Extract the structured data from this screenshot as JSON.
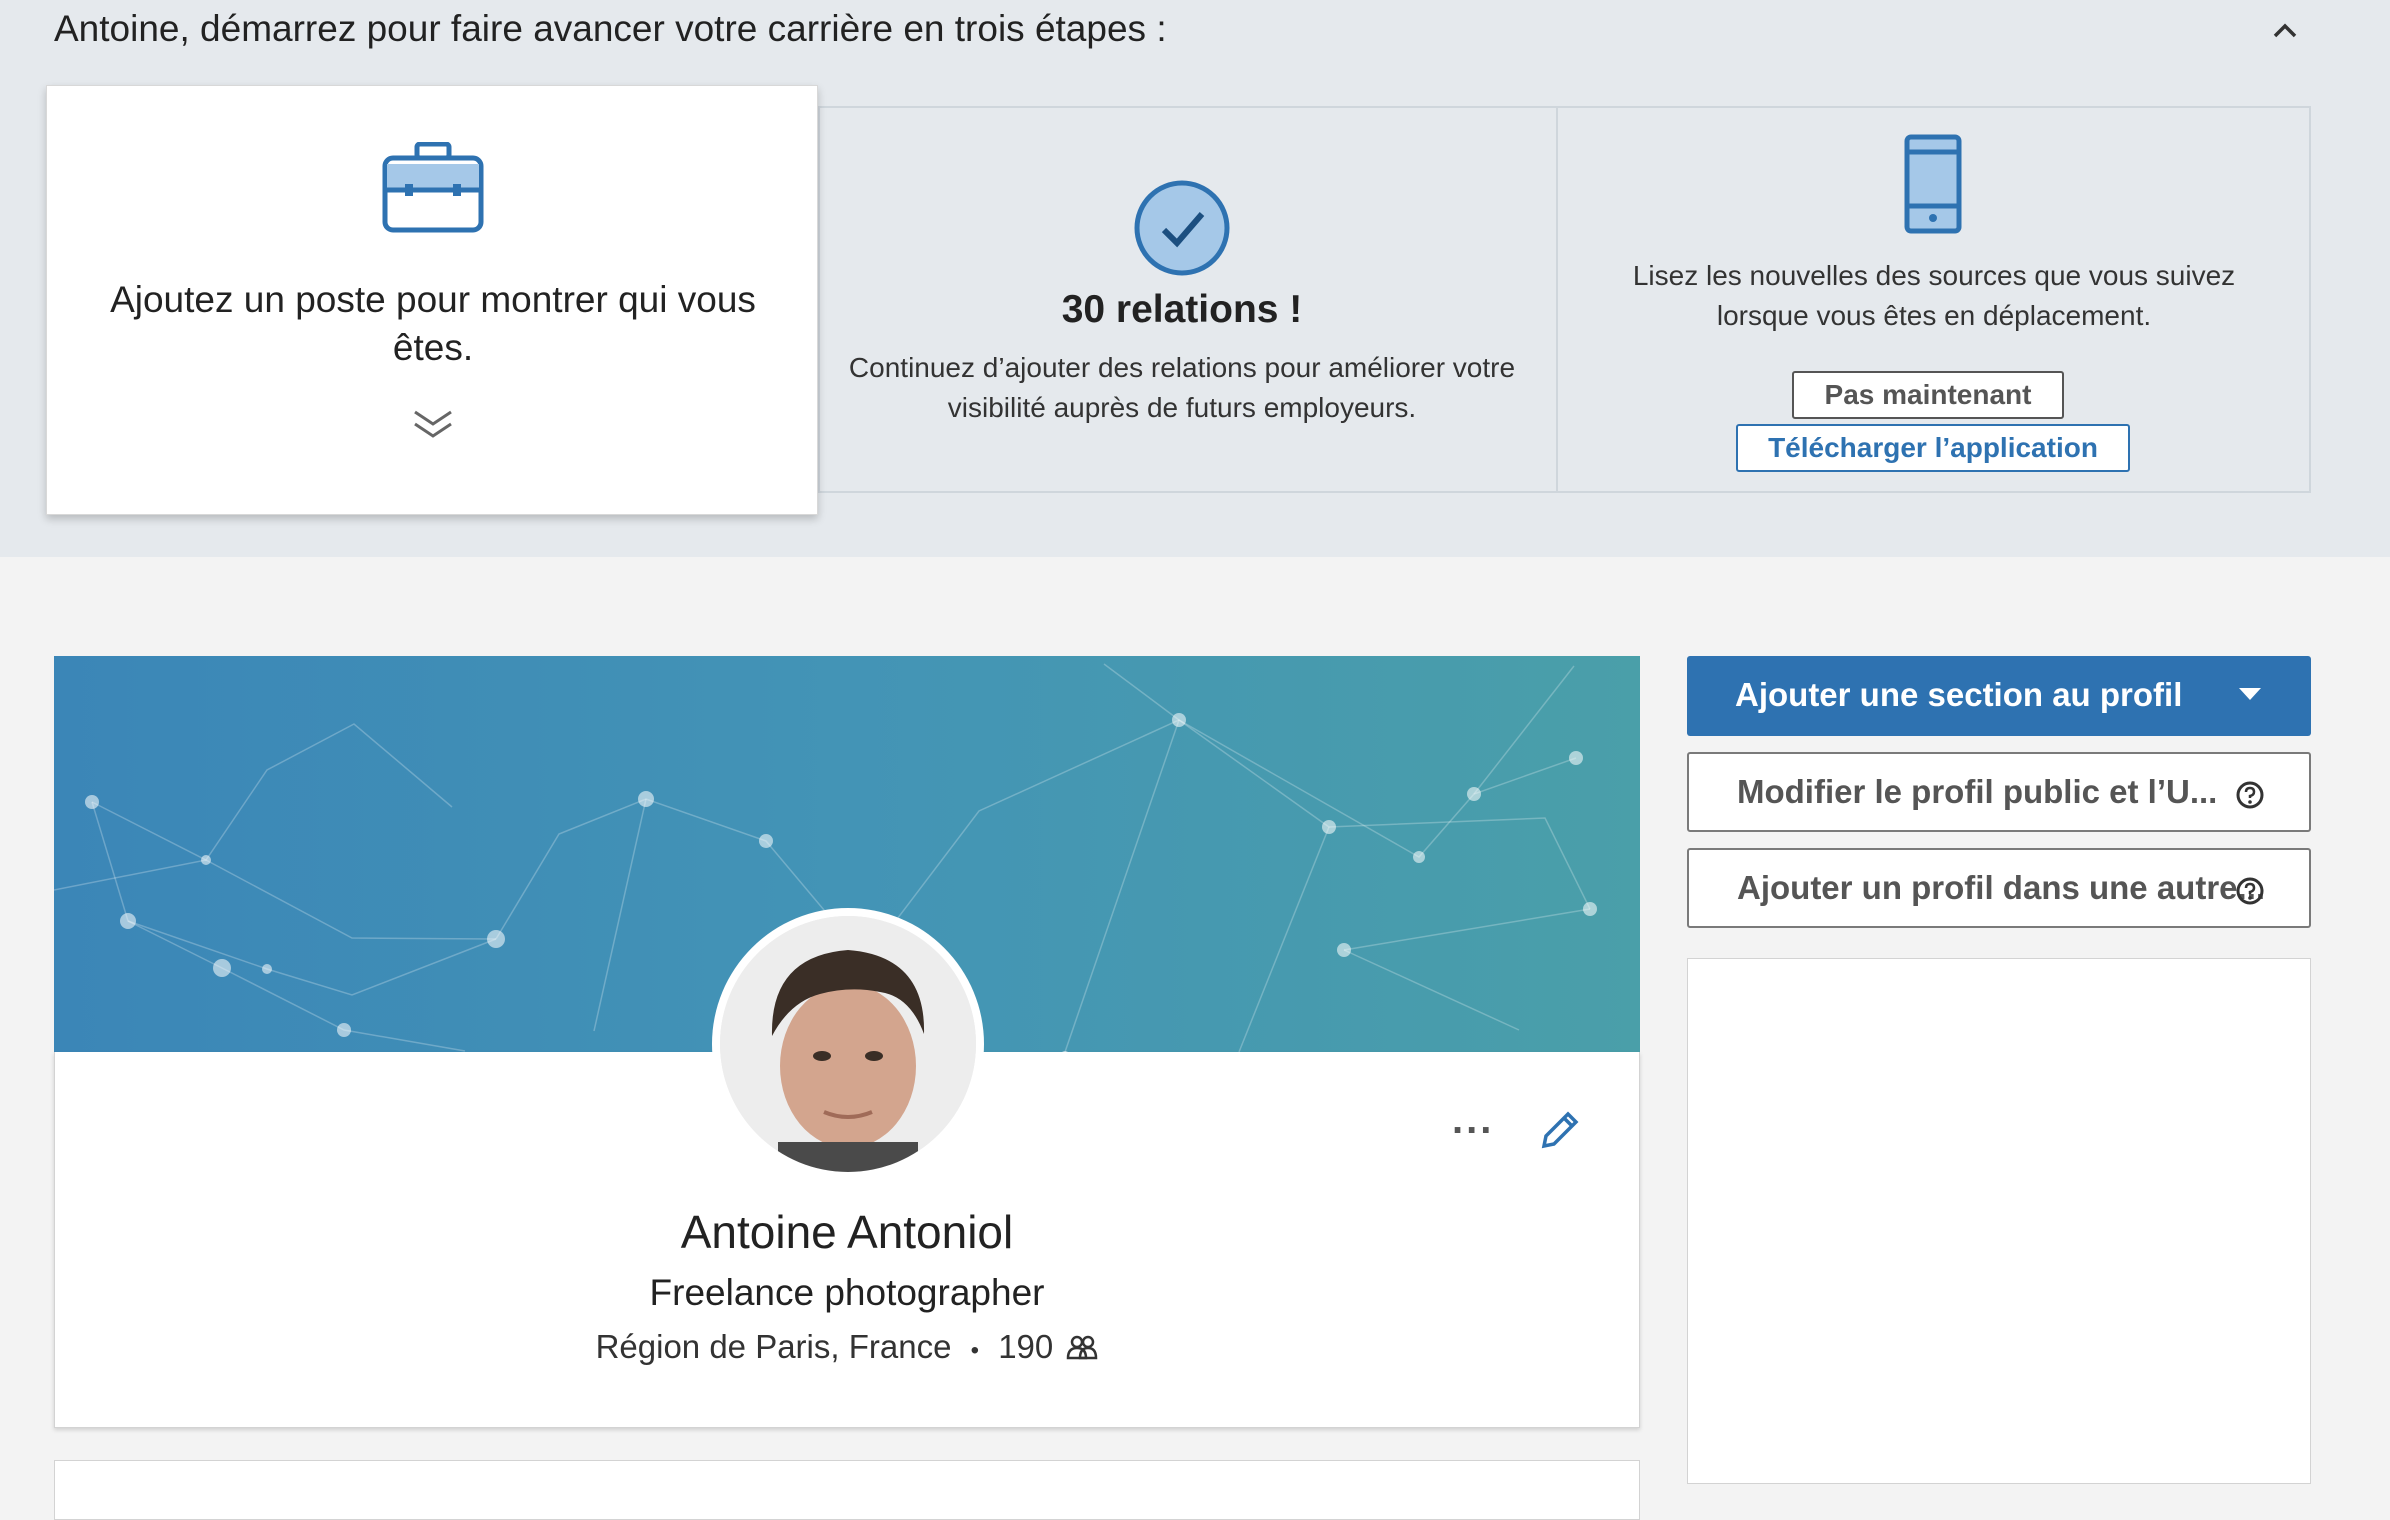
{
  "banner": {
    "title": "Antoine, démarrez pour faire avancer votre carrière en trois étapes :",
    "step1": {
      "text": "Ajoutez un poste pour montrer qui vous êtes."
    },
    "step2": {
      "title": "30 relations !",
      "text": "Continuez d’ajouter des relations pour améliorer votre visibilité auprès de futurs employeurs."
    },
    "step3": {
      "text": "Lisez les nouvelles des sources que vous suivez lorsque vous êtes en déplacement.",
      "not_now": "Pas maintenant",
      "download": "Télécharger l’application"
    }
  },
  "profile": {
    "name": "Antoine Antoniol",
    "headline": "Freelance photographer",
    "location": "Région de Paris, France",
    "sep": "•",
    "connections": "190"
  },
  "sidebar": {
    "add_section": "Ajouter une section au profil",
    "edit_public": "Modifier le profil public et l’U...",
    "add_language": "Ajouter un profil dans une autre..."
  },
  "colors": {
    "primary": "#2e72b1",
    "cover": "#4394b6",
    "banner_bg": "#e5e9ed"
  }
}
